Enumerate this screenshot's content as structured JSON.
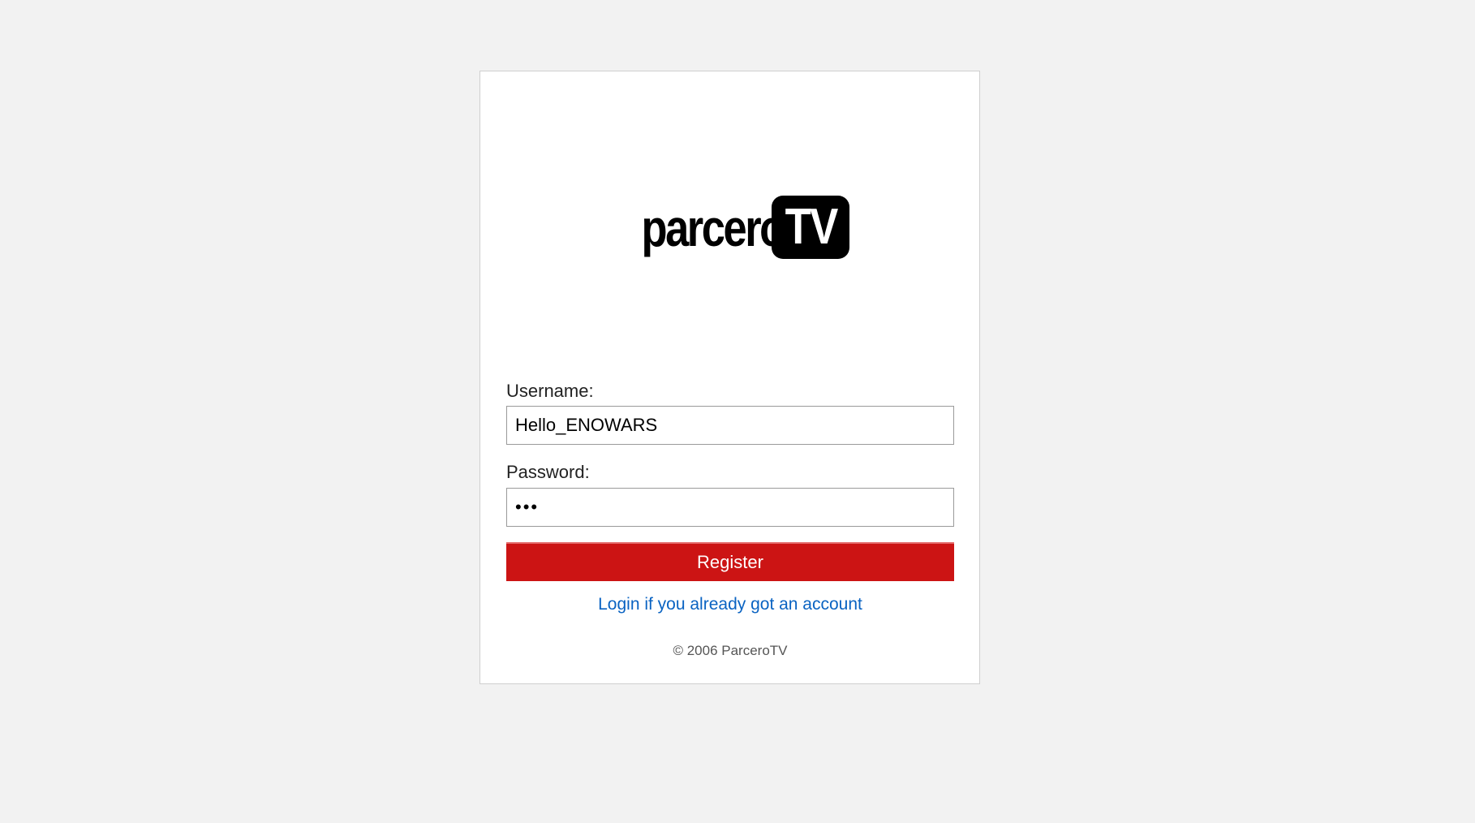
{
  "logo": {
    "text": "parcero",
    "badge": "TV"
  },
  "form": {
    "username_label": "Username:",
    "username_value": "Hello_ENOWARS",
    "password_label": "Password:",
    "password_value": "•••",
    "register_label": "Register",
    "login_link": "Login if you already got an account"
  },
  "footer": {
    "copyright": "© 2006 ParceroTV"
  },
  "colors": {
    "page_background": "#f2f2f2",
    "button": "#cc1414",
    "link": "#0a63c2"
  }
}
